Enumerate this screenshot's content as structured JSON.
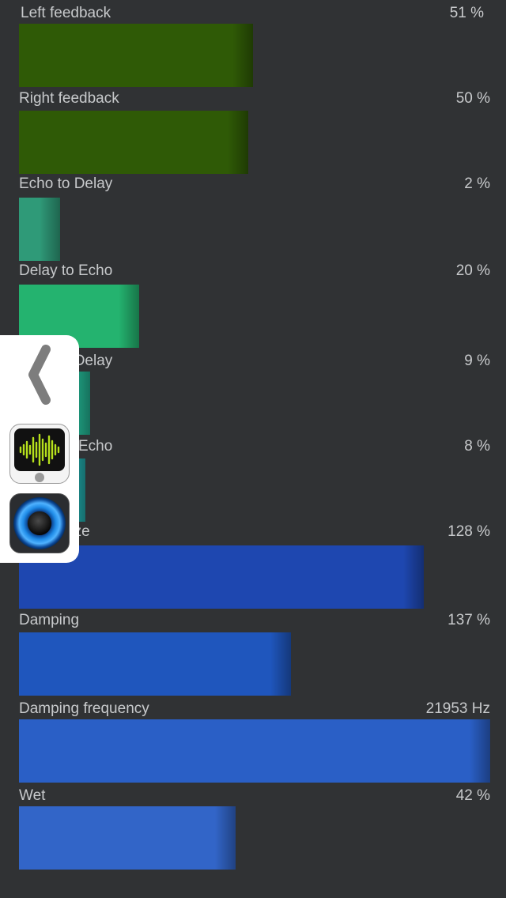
{
  "parameters": [
    {
      "label": "Left feedback",
      "value_text": "51 %",
      "fill_fraction": 0.497,
      "color": "#2f5a06"
    },
    {
      "label": "Right feedback",
      "value_text": "50 %",
      "fill_fraction": 0.487,
      "color": "#2f5a06"
    },
    {
      "label": "Echo to Delay",
      "value_text": "2 %",
      "fill_fraction": 0.087,
      "color": "#2f9a78"
    },
    {
      "label": "Delay to Echo",
      "value_text": "20 %",
      "fill_fraction": 0.255,
      "color": "#24b36f"
    },
    {
      "label": "Echo to Delay",
      "value_text": "9 %",
      "fill_fraction": 0.151,
      "color": "#22ae8e"
    },
    {
      "label": "Delay to Echo",
      "value_text": "8 %",
      "fill_fraction": 0.141,
      "color": "#22aaaa"
    },
    {
      "label": "Room size",
      "value_text": "128 %",
      "fill_fraction": 0.859,
      "color": "#1e47b0"
    },
    {
      "label": "Damping",
      "value_text": "137 %",
      "fill_fraction": 0.577,
      "color": "#1f56bd"
    },
    {
      "label": "Damping frequency",
      "value_text": "21953 Hz",
      "fill_fraction": 1.0,
      "color": "#2a5fc6"
    },
    {
      "label": "Wet",
      "value_text": "42 %",
      "fill_fraction": 0.46,
      "color": "#3265c8"
    }
  ],
  "side_panel": {
    "back_icon": "chevron-left-icon",
    "apps": [
      {
        "icon": "audio-waveform-app-icon"
      },
      {
        "icon": "blue-ring-app-icon"
      }
    ]
  }
}
